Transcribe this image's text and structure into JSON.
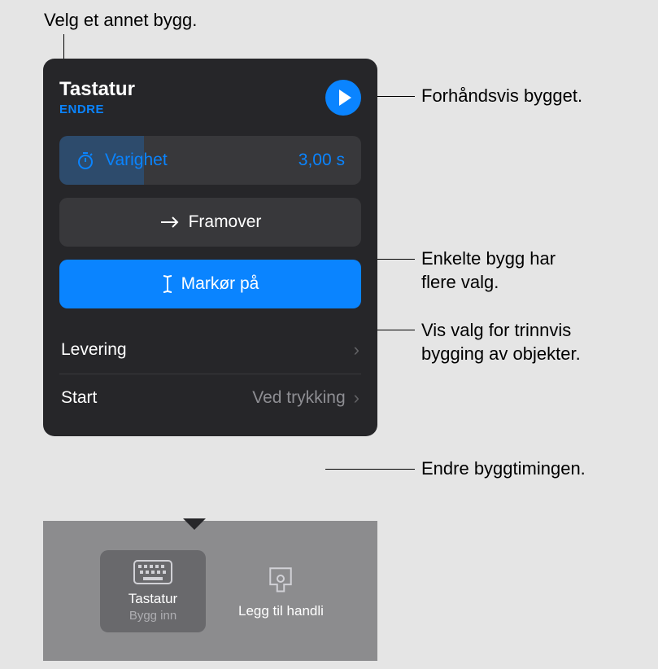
{
  "callouts": {
    "change_build": "Velg et annet bygg.",
    "preview_build": "Forhåndsvis bygget.",
    "more_options_line1": "Enkelte bygg har",
    "more_options_line2": "flere valg.",
    "stepwise_line1": "Vis valg for trinnvis",
    "stepwise_line2": "bygging av objekter.",
    "change_timing": "Endre byggtimingen."
  },
  "panel": {
    "title": "Tastatur",
    "change_label": "ENDRE",
    "duration_label": "Varighet",
    "duration_value": "3,00 s",
    "forward_label": "Framover",
    "cursor_label": "Markør på",
    "delivery_label": "Levering",
    "start_label": "Start",
    "start_value": "Ved trykking"
  },
  "bottom": {
    "tile_title": "Tastatur",
    "tile_subtitle": "Bygg inn",
    "action_label": "Legg til handli"
  }
}
